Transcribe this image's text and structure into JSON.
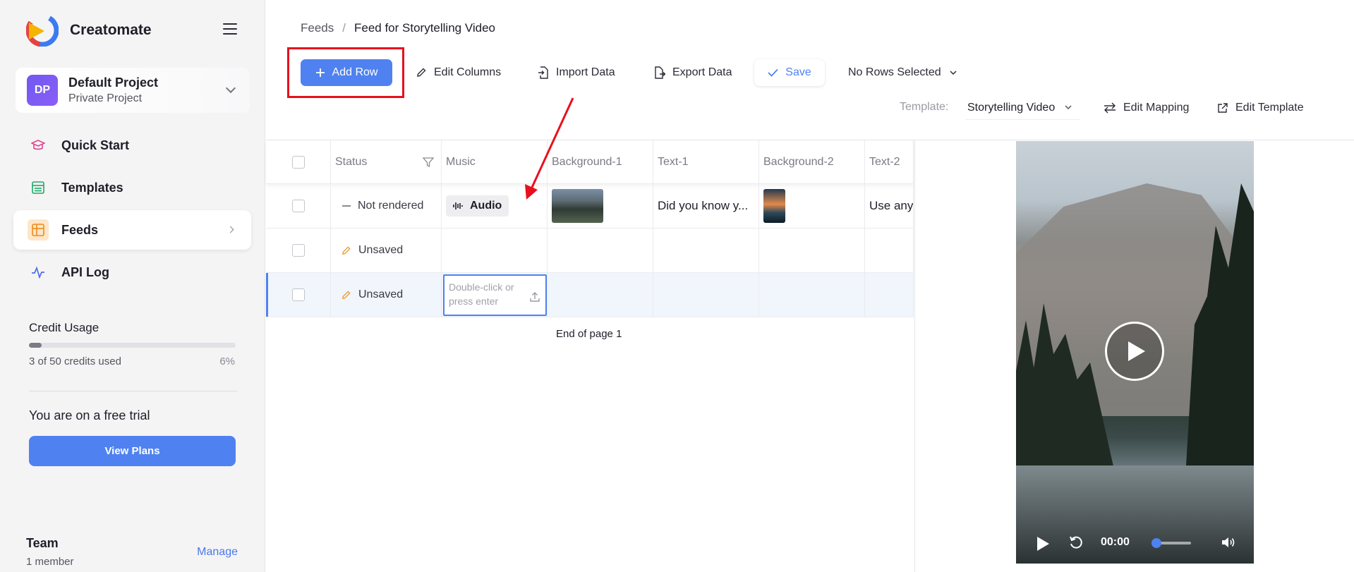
{
  "brand": {
    "name": "Creatomate"
  },
  "project": {
    "initials": "DP",
    "name": "Default Project",
    "type": "Private Project"
  },
  "nav": [
    {
      "label": "Quick Start",
      "icon": "graduation-cap-icon"
    },
    {
      "label": "Templates",
      "icon": "templates-icon"
    },
    {
      "label": "Feeds",
      "icon": "feeds-grid-icon",
      "active": true
    },
    {
      "label": "API Log",
      "icon": "activity-icon"
    }
  ],
  "credits": {
    "title": "Credit Usage",
    "used_text": "3 of 50 credits used",
    "percent_text": "6%",
    "fraction": 0.06
  },
  "trial": {
    "text": "You are on a free trial",
    "button": "View Plans"
  },
  "team": {
    "title": "Team",
    "members": "1 member",
    "manage": "Manage"
  },
  "breadcrumb": {
    "parent": "Feeds",
    "separator": "/",
    "current": "Feed for Storytelling Video"
  },
  "toolbar": {
    "add_row": "Add Row",
    "edit_columns": "Edit Columns",
    "import_data": "Import Data",
    "export_data": "Export Data",
    "save": "Save",
    "rows_selected": "No Rows Selected"
  },
  "template_bar": {
    "label": "Template:",
    "selected": "Storytelling Video",
    "edit_mapping": "Edit Mapping",
    "edit_template": "Edit Template"
  },
  "table": {
    "columns": [
      "Status",
      "Music",
      "Background-1",
      "Text-1",
      "Background-2",
      "Text-2"
    ],
    "rows": [
      {
        "status": "Not rendered",
        "music": "Audio",
        "text1": "Did you know y...",
        "text2": "Use any"
      },
      {
        "status": "Unsaved"
      },
      {
        "status": "Unsaved",
        "editing_placeholder": "Double-click or press enter"
      }
    ],
    "footer": "End of page 1"
  },
  "video": {
    "time": "00:00",
    "progress": 0.0
  },
  "colors": {
    "accent": "#4f82f0",
    "highlight": "#e8101c"
  }
}
